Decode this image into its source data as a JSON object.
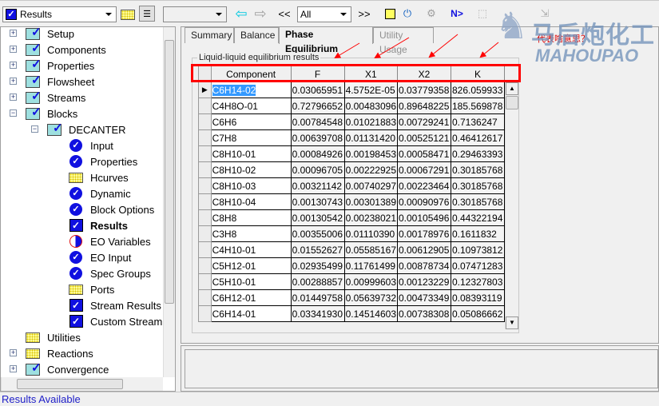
{
  "toolbar": {
    "navigator_value": "Results",
    "blank_combo_value": "",
    "filter_value": "All",
    "prev_label": "<<",
    "next_label": ">>",
    "n_label": "N>"
  },
  "tree": [
    {
      "label": "Setup",
      "level": 0,
      "icon": "folder-check-icon",
      "expand": "+"
    },
    {
      "label": "Components",
      "level": 0,
      "icon": "folder-check-icon",
      "expand": "+"
    },
    {
      "label": "Properties",
      "level": 0,
      "icon": "folder-check-icon",
      "expand": "+"
    },
    {
      "label": "Flowsheet",
      "level": 0,
      "icon": "folder-check-icon",
      "expand": "+"
    },
    {
      "label": "Streams",
      "level": 0,
      "icon": "folder-check-icon",
      "expand": "+"
    },
    {
      "label": "Blocks",
      "level": 0,
      "icon": "folder-check-icon",
      "expand": "-"
    },
    {
      "label": "DECANTER",
      "level": 1,
      "icon": "folder-check-icon",
      "expand": "-"
    },
    {
      "label": "Input",
      "level": 2,
      "icon": "check-circle-icon"
    },
    {
      "label": "Properties",
      "level": 2,
      "icon": "check-circle-icon"
    },
    {
      "label": "Hcurves",
      "level": 2,
      "icon": "folder-icon"
    },
    {
      "label": "Dynamic",
      "level": 2,
      "icon": "check-circle-icon"
    },
    {
      "label": "Block Options",
      "level": 2,
      "icon": "check-circle-icon"
    },
    {
      "label": "Results",
      "level": 2,
      "icon": "check-square-icon",
      "bold": true
    },
    {
      "label": "EO Variables",
      "level": 2,
      "icon": "eo-icon"
    },
    {
      "label": "EO Input",
      "level": 2,
      "icon": "check-circle-icon"
    },
    {
      "label": "Spec Groups",
      "level": 2,
      "icon": "check-circle-icon"
    },
    {
      "label": "Ports",
      "level": 2,
      "icon": "folder-icon"
    },
    {
      "label": "Stream Results",
      "level": 2,
      "icon": "check-square-icon"
    },
    {
      "label": "Custom Stream",
      "level": 2,
      "icon": "check-square-icon"
    },
    {
      "label": "Utilities",
      "level": 0,
      "icon": "folder-icon"
    },
    {
      "label": "Reactions",
      "level": 0,
      "icon": "folder-icon",
      "expand": "+"
    },
    {
      "label": "Convergence",
      "level": 0,
      "icon": "folder-check-icon",
      "expand": "+"
    }
  ],
  "tabs": [
    {
      "label": "Summary"
    },
    {
      "label": "Balance"
    },
    {
      "label": "Phase Equilibrium",
      "active": true
    },
    {
      "label": "Utility Usage",
      "disabled": true
    }
  ],
  "group_label": "Liquid-liquid equilibrium results",
  "table": {
    "headers": [
      "Component",
      "F",
      "X1",
      "X2",
      "K"
    ],
    "rows": [
      [
        "C6H14-02",
        "0.03065951",
        "4.5752E-05",
        "0.03779358",
        "826.059933"
      ],
      [
        "C4H8O-01",
        "0.72796652",
        "0.00483096",
        "0.89648225",
        "185.569878"
      ],
      [
        "C6H6",
        "0.00784548",
        "0.01021883",
        "0.00729241",
        "0.7136247"
      ],
      [
        "C7H8",
        "0.00639708",
        "0.01131420",
        "0.00525121",
        "0.46412617"
      ],
      [
        "C8H10-01",
        "0.00084926",
        "0.00198453",
        "0.00058471",
        "0.29463393"
      ],
      [
        "C8H10-02",
        "0.00096705",
        "0.00222925",
        "0.00067291",
        "0.30185768"
      ],
      [
        "C8H10-03",
        "0.00321142",
        "0.00740297",
        "0.00223464",
        "0.30185768"
      ],
      [
        "C8H10-04",
        "0.00130743",
        "0.00301389",
        "0.00090976",
        "0.30185768"
      ],
      [
        "C8H8",
        "0.00130542",
        "0.00238021",
        "0.00105496",
        "0.44322194"
      ],
      [
        "C3H8",
        "0.00355006",
        "0.01110390",
        "0.00178976",
        "0.1611832"
      ],
      [
        "C4H10-01",
        "0.01552627",
        "0.05585167",
        "0.00612905",
        "0.10973812"
      ],
      [
        "C5H12-01",
        "0.02935499",
        "0.11761499",
        "0.00878734",
        "0.07471283"
      ],
      [
        "C5H10-01",
        "0.00288857",
        "0.00999603",
        "0.00123229",
        "0.12327803"
      ],
      [
        "C6H12-01",
        "0.01449758",
        "0.05639732",
        "0.00473349",
        "0.08393119"
      ],
      [
        "C6H14-01",
        "0.03341930",
        "0.14514603",
        "0.00738308",
        "0.05086662"
      ]
    ]
  },
  "annotation": "代表啥意思？",
  "watermark": {
    "cn": "马后炮化工",
    "en": "MAHOUPAO"
  },
  "status": "Results Available",
  "colors": {
    "accent": "#1010e0",
    "annotation": "#ff0000",
    "status_text": "#2020c8"
  }
}
